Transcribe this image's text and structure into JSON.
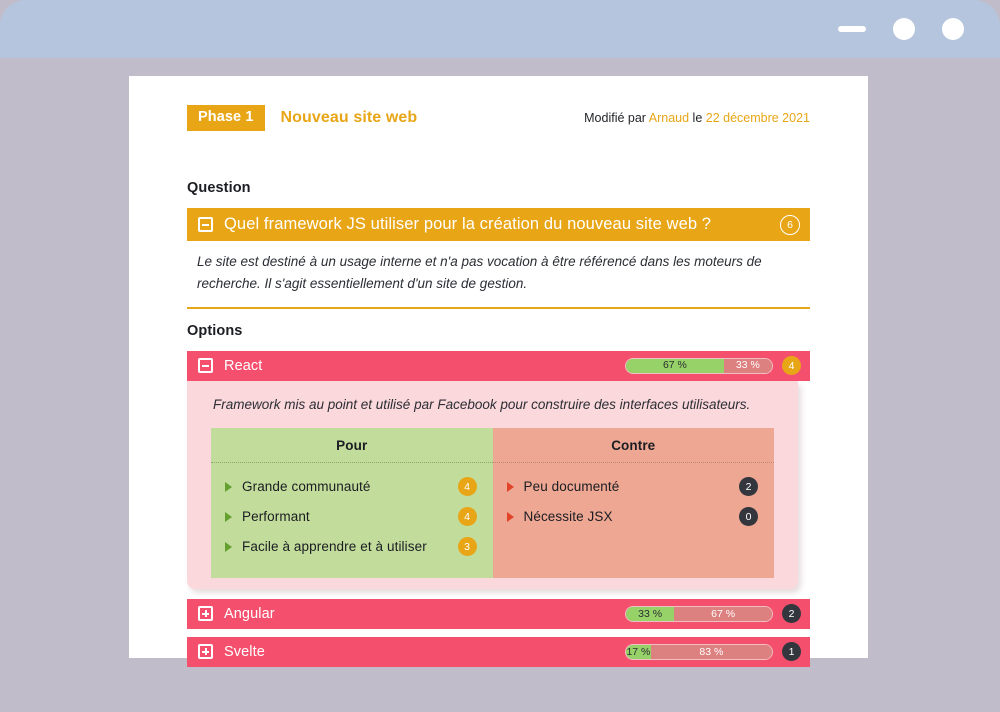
{
  "window": {
    "minimize_label": "minimize",
    "maximize_label": "maximize",
    "close_label": "close"
  },
  "header": {
    "phase_badge": "Phase 1",
    "title": "Nouveau site web",
    "modified_prefix": "Modifié par ",
    "modified_author": "Arnaud",
    "modified_middle": " le ",
    "modified_date": "22 décembre 2021"
  },
  "sections": {
    "question_label": "Question",
    "options_label": "Options"
  },
  "question": {
    "text": "Quel framework JS utiliser pour la création du nouveau site web ?",
    "count": "6",
    "description": "Le site est destiné à un usage interne et n'a pas vocation à être référencé dans les moteurs de recherche. Il s'agit essentiellement d'un site de gestion."
  },
  "table_headers": {
    "pros": "Pour",
    "cons": "Contre"
  },
  "options": [
    {
      "name": "React",
      "expanded": true,
      "count": "4",
      "count_style": "orange",
      "pro_percent": "67 %",
      "con_percent": "33 %",
      "pro_value": 67,
      "con_value": 33,
      "description": "Framework mis au point et utilisé par Facebook pour construire des interfaces utilisateurs.",
      "pros": [
        {
          "label": "Grande communauté",
          "count": "4"
        },
        {
          "label": "Performant",
          "count": "4"
        },
        {
          "label": "Facile à apprendre et à utiliser",
          "count": "3"
        }
      ],
      "cons": [
        {
          "label": "Peu documenté",
          "count": "2"
        },
        {
          "label": "Nécessite JSX",
          "count": "0"
        }
      ]
    },
    {
      "name": "Angular",
      "expanded": false,
      "count": "2",
      "count_style": "dark",
      "pro_percent": "33 %",
      "con_percent": "67 %",
      "pro_value": 33,
      "con_value": 67
    },
    {
      "name": "Svelte",
      "expanded": false,
      "count": "1",
      "count_style": "dark",
      "pro_percent": "17 %",
      "con_percent": "83 %",
      "pro_value": 17,
      "con_value": 83
    }
  ],
  "colors": {
    "accent_orange": "#e8a617",
    "option_pink": "#f4506e",
    "panel_pink": "#fbd8dc",
    "pros_green": "#c2dc9b",
    "cons_salmon": "#eda793",
    "bar_green": "#96d267",
    "bar_red": "#dd8080",
    "titlebar": "#b5c5dd",
    "desktop": "#c0bcc9"
  }
}
